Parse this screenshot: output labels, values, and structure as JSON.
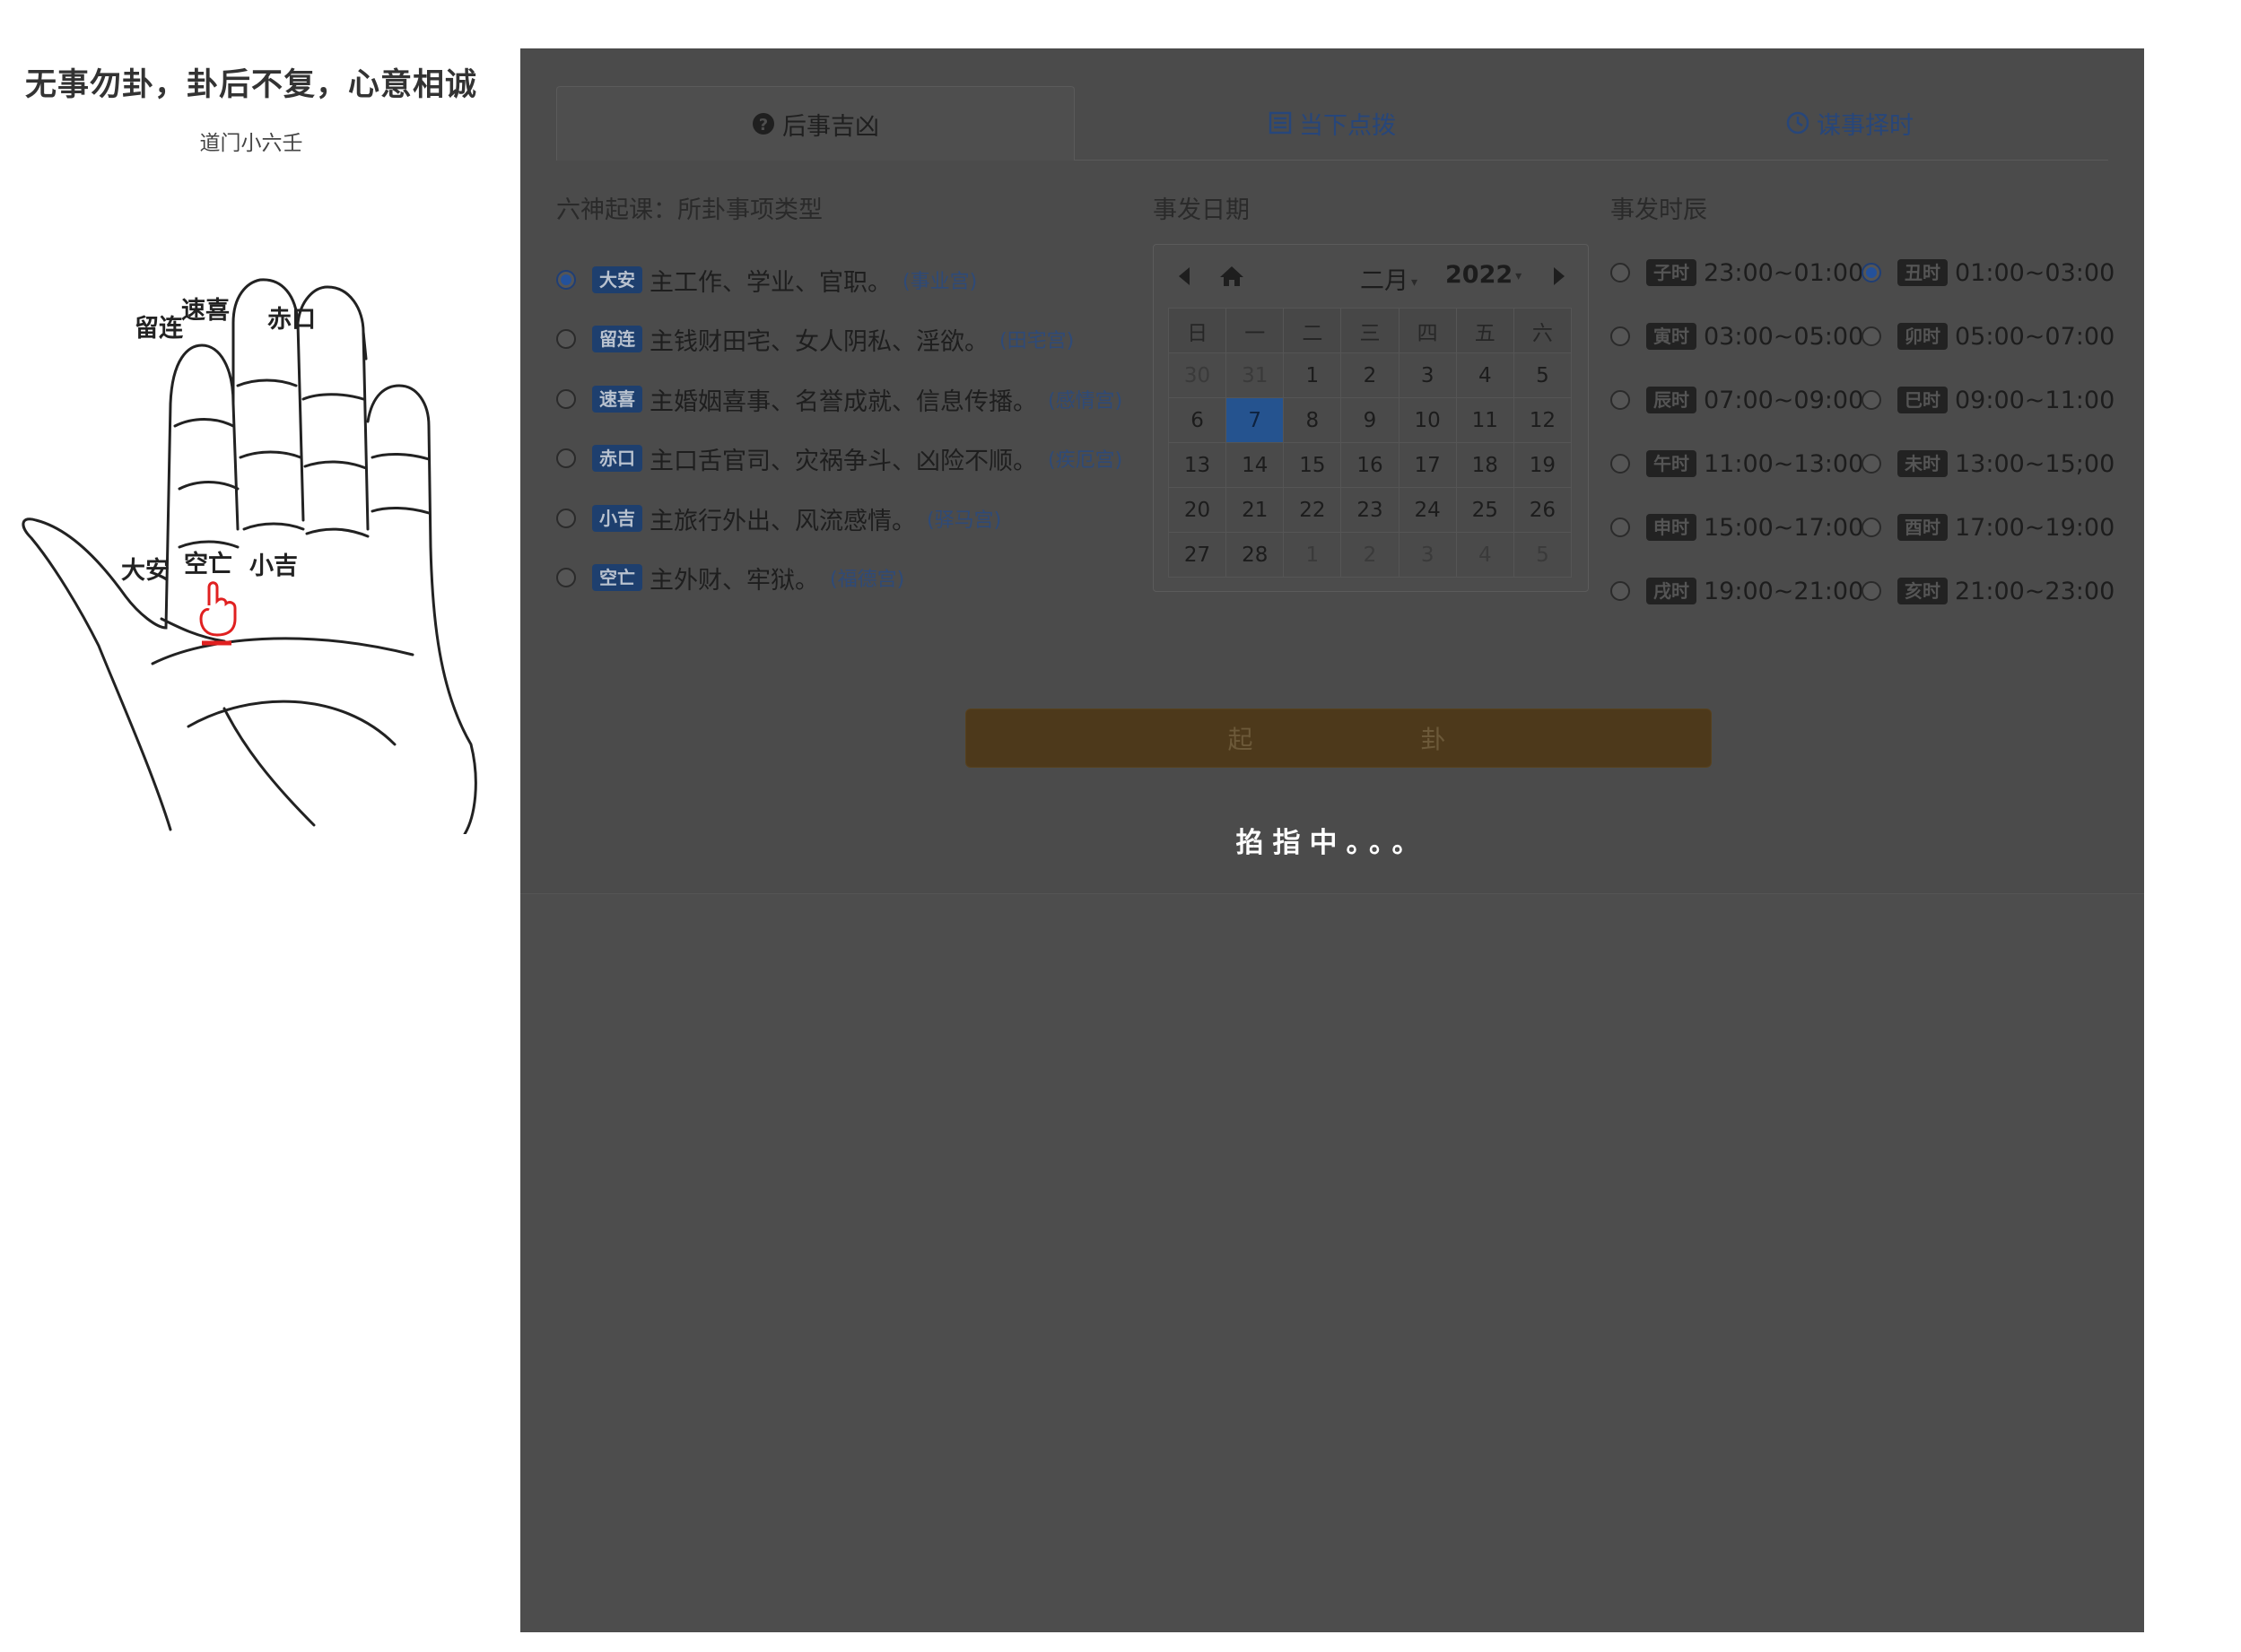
{
  "sidebar": {
    "motto": "无事勿卦，卦后不复，心意相诚",
    "subtitle": "道门小六壬",
    "hand_labels": {
      "liulian": "留连",
      "suxi": "速喜",
      "chikou": "赤口",
      "daan": "大安",
      "kongwang": "空亡",
      "xiaoji": "小吉"
    }
  },
  "tabs": [
    {
      "label": "后事吉凶",
      "icon": "question-circle-icon",
      "active": true
    },
    {
      "label": "当下点拨",
      "icon": "list-alt-icon",
      "active": false
    },
    {
      "label": "谋事择时",
      "icon": "clock-icon",
      "active": false
    }
  ],
  "sections": {
    "type_title": "六神起课：所卦事项类型",
    "date_title": "事发日期",
    "hour_title": "事发时辰"
  },
  "options": [
    {
      "tag": "大安",
      "text": "主工作、学业、官职。",
      "note": "(事业宫)",
      "checked": true
    },
    {
      "tag": "留连",
      "text": "主钱财田宅、女人阴私、淫欲。",
      "note": "(田宅宫)",
      "checked": false
    },
    {
      "tag": "速喜",
      "text": "主婚姻喜事、名誉成就、信息传播。",
      "note": "(感情宫)",
      "checked": false
    },
    {
      "tag": "赤口",
      "text": "主口舌官司、灾祸争斗、凶险不顺。",
      "note": "(疾厄宫)",
      "checked": false
    },
    {
      "tag": "小吉",
      "text": "主旅行外出、风流感情。",
      "note": "(驿马宫)",
      "checked": false
    },
    {
      "tag": "空亡",
      "text": "主外财、牢狱。",
      "note": "(福德宫)",
      "checked": false
    }
  ],
  "calendar": {
    "month": "二月",
    "year": "2022",
    "weekdays": [
      "日",
      "一",
      "二",
      "三",
      "四",
      "五",
      "六"
    ],
    "weeks": [
      [
        "30",
        "31",
        "1",
        "2",
        "3",
        "4",
        "5"
      ],
      [
        "6",
        "7",
        "8",
        "9",
        "10",
        "11",
        "12"
      ],
      [
        "13",
        "14",
        "15",
        "16",
        "17",
        "18",
        "19"
      ],
      [
        "20",
        "21",
        "22",
        "23",
        "24",
        "25",
        "26"
      ],
      [
        "27",
        "28",
        "1",
        "2",
        "3",
        "4",
        "5"
      ]
    ],
    "selected_day": "7"
  },
  "hours": [
    {
      "tag": "子时",
      "range": "23:00~01:00",
      "checked": false
    },
    {
      "tag": "丑时",
      "range": "01:00~03:00",
      "checked": true
    },
    {
      "tag": "寅时",
      "range": "03:00~05:00",
      "checked": false
    },
    {
      "tag": "卯时",
      "range": "05:00~07:00",
      "checked": false
    },
    {
      "tag": "辰时",
      "range": "07:00~09:00",
      "checked": false
    },
    {
      "tag": "巳时",
      "range": "09:00~11:00",
      "checked": false
    },
    {
      "tag": "午时",
      "range": "11:00~13:00",
      "checked": false
    },
    {
      "tag": "未时",
      "range": "13:00~15;00",
      "checked": false
    },
    {
      "tag": "申时",
      "range": "15:00~17:00",
      "checked": false
    },
    {
      "tag": "酉时",
      "range": "17:00~19:00",
      "checked": false
    },
    {
      "tag": "戌时",
      "range": "19:00~21:00",
      "checked": false
    },
    {
      "tag": "亥时",
      "range": "21:00~23:00",
      "checked": false
    }
  ],
  "start_button": {
    "char1": "起",
    "char2": "卦"
  },
  "status": "掐指中。。。",
  "colors": {
    "overlay": "#4d4d4d",
    "accent": "#25538f",
    "button": "#4d391b"
  }
}
